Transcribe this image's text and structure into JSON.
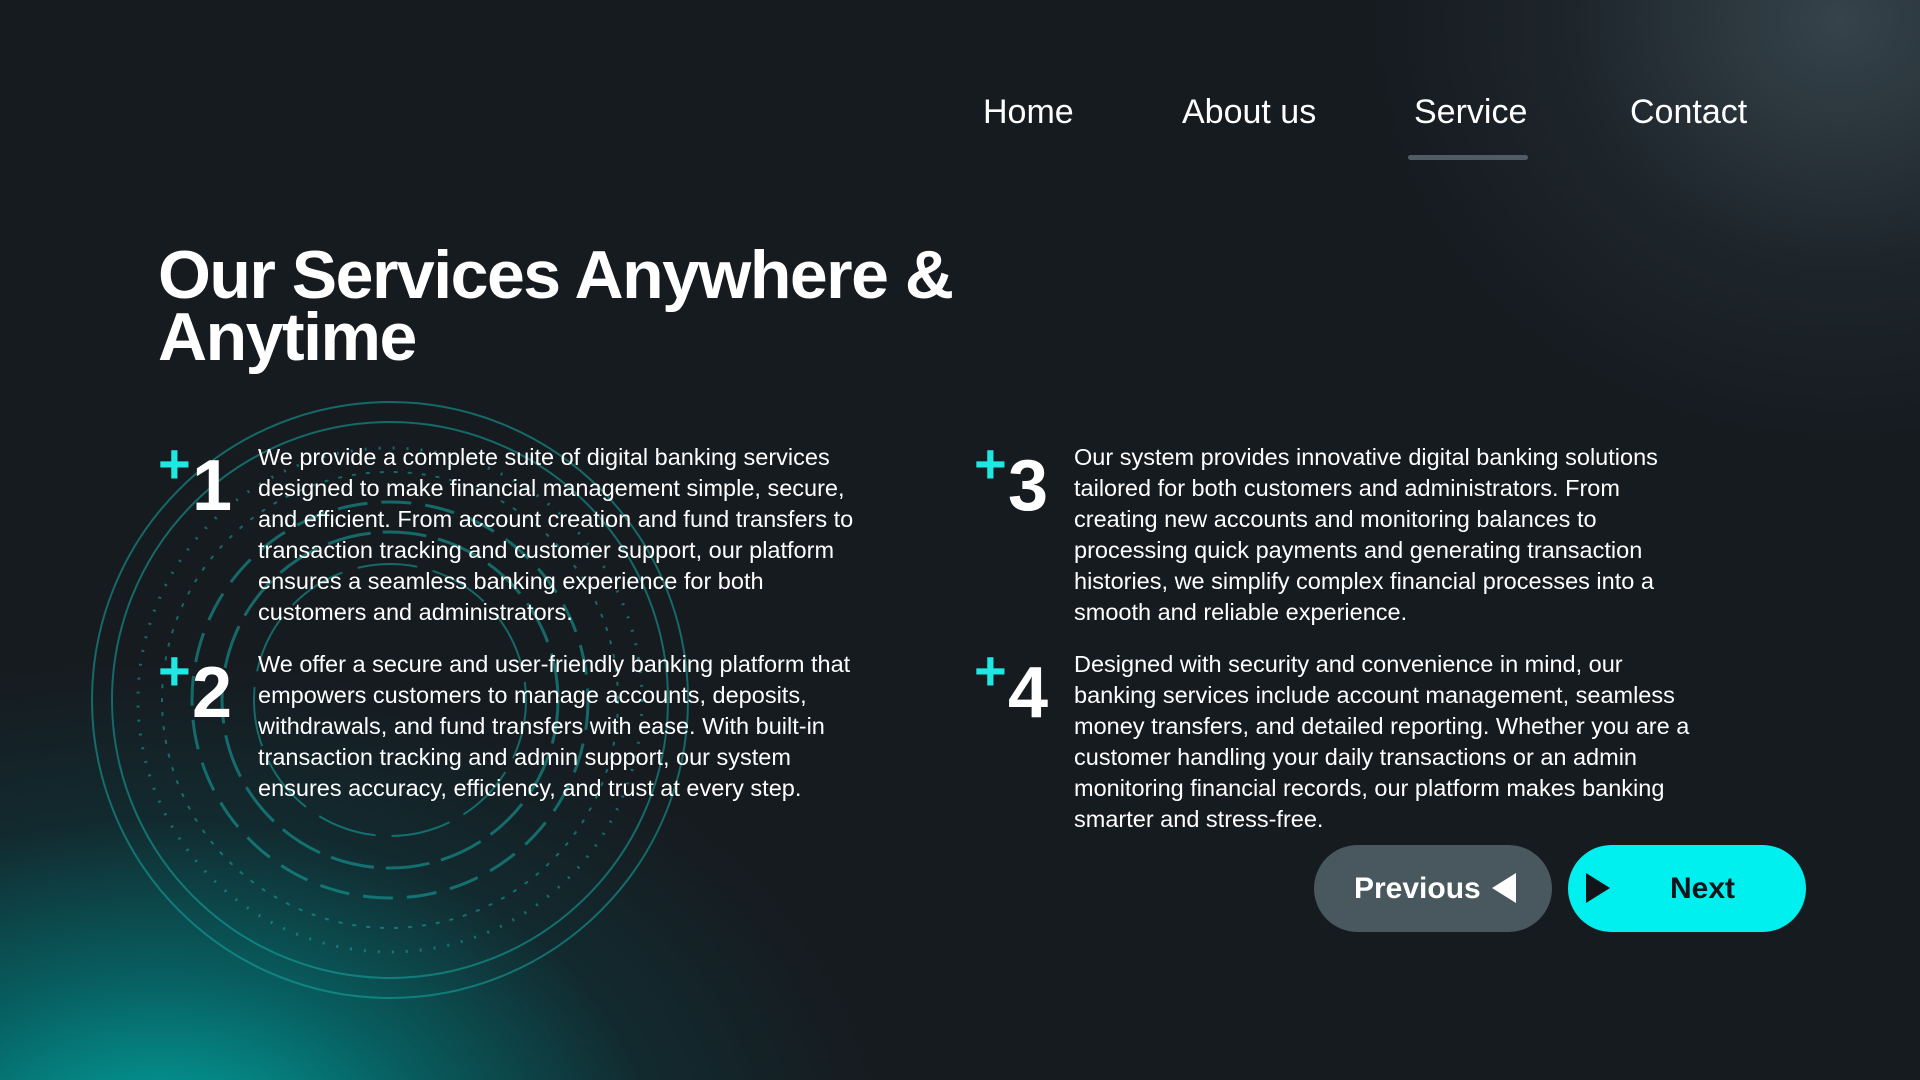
{
  "nav": {
    "items": [
      {
        "label": "Home"
      },
      {
        "label": "About us"
      },
      {
        "label": "Service",
        "active": true
      },
      {
        "label": "Contact"
      }
    ]
  },
  "heading": "Our Services Anywhere & Anytime",
  "services": [
    {
      "number": "1",
      "text": "We provide a complete suite of digital banking services designed to make financial management simple, secure, and efficient. From account creation and fund transfers to transaction tracking and customer support, our platform ensures a seamless banking experience for both customers and administrators."
    },
    {
      "number": "2",
      "text": "We offer a secure and user-friendly banking platform that empowers customers to manage accounts, deposits, withdrawals, and fund transfers with ease. With built-in transaction tracking and admin support, our system ensures accuracy, efficiency, and trust at every step."
    },
    {
      "number": "3",
      "text": "Our system provides innovative digital banking solutions tailored for both customers and administrators. From creating new accounts and monitoring balances to processing quick payments and generating transaction histories, we simplify complex financial processes into a smooth and reliable experience."
    },
    {
      "number": "4",
      "text": "Designed with security and convenience in mind, our banking services include account management, seamless money transfers, and detailed reporting. Whether you are a customer handling your daily transactions or an admin monitoring financial records, our platform makes banking smarter and stress-free."
    }
  ],
  "plus_symbol": "+",
  "buttons": {
    "previous": "Previous",
    "next": "Next"
  },
  "colors": {
    "background": "#161b20",
    "accent": "#00f0f0",
    "plus": "#1ee8e4",
    "prev_button": "#49575e",
    "nav_underline": "#4f5c66"
  },
  "icons": {
    "previous": "triangle-left-icon",
    "next": "triangle-right-icon",
    "decoration": "concentric-rings"
  }
}
